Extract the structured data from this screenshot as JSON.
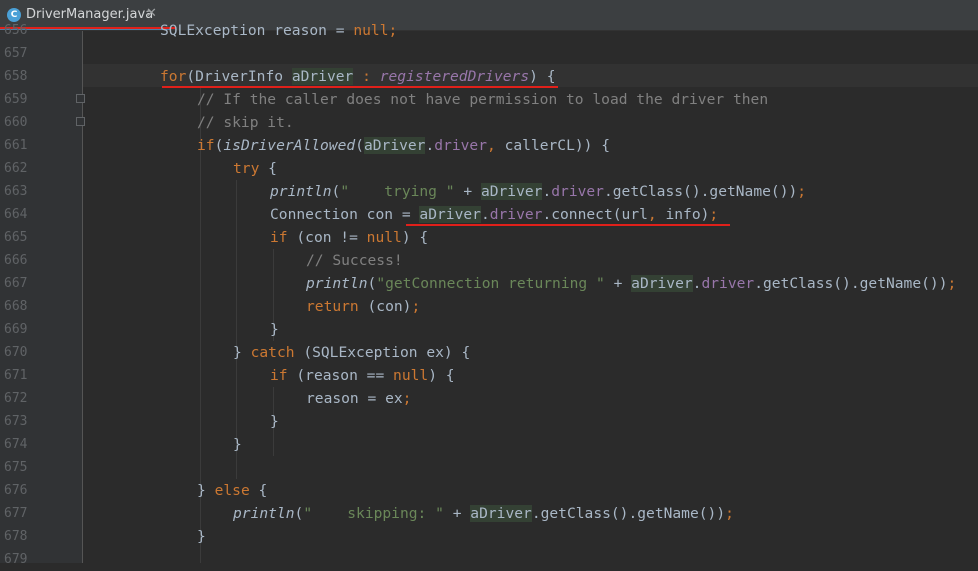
{
  "editor_tab": {
    "icon": "C",
    "file_name": "DriverManager.java",
    "close": "✕"
  },
  "line_numbers": [
    "656",
    "657",
    "658",
    "659",
    "660",
    "661",
    "662",
    "663",
    "664",
    "665",
    "666",
    "667",
    "668",
    "669",
    "670",
    "671",
    "672",
    "673",
    "674",
    "675",
    "676",
    "677",
    "678",
    "679"
  ],
  "code": {
    "l656": {
      "type": "SQLException",
      "name": "reason",
      "op": "=",
      "null": "null",
      "semi": ";"
    },
    "l658": {
      "kw": "for",
      "paren": "(",
      "type": "DriverInfo",
      "var": "aDriver",
      "colon": ":",
      "field": "registeredDrivers",
      "close": ")",
      "brace": "{"
    },
    "l659": {
      "comment": "// If the caller does not have permission to load the driver then"
    },
    "l660": {
      "comment": "// skip it."
    },
    "l661": {
      "kw": "if",
      "paren": "(",
      "method": "isDriverAllowed",
      "paren2": "(",
      "var": "aDriver",
      "dot": ".",
      "field": "driver",
      "comma": ",",
      "arg": "callerCL",
      "close": "))",
      "brace": "{"
    },
    "l662": {
      "kw": "try",
      "brace": "{"
    },
    "l663": {
      "method": "println",
      "paren": "(",
      "str": "\"    trying \"",
      "plus": "+",
      "var": "aDriver",
      "dot": ".",
      "field": "driver",
      "rest": ".getClass().getName())",
      "semi": ";"
    },
    "l664": {
      "type": "Connection",
      "name": "con",
      "op": "=",
      "var": "aDriver",
      "dot": ".",
      "field": "driver",
      "rest": ".connect(url",
      "comma": ",",
      "arg": "info)",
      "semi": ";"
    },
    "l665": {
      "kw": "if",
      "paren": "(con != ",
      "null": "null",
      "close": ")",
      "brace": "{"
    },
    "l666": {
      "comment": "// Success!"
    },
    "l667": {
      "method": "println",
      "paren": "(",
      "str": "\"getConnection returning \"",
      "plus": "+",
      "var": "aDriver",
      "dot": ".",
      "field": "driver",
      "rest": ".getClass().getName())",
      "semi": ";"
    },
    "l668": {
      "kw": "return",
      "rest": "(con)",
      "semi": ";"
    },
    "l669": {
      "brace": "}"
    },
    "l670": {
      "brace": "}",
      "kw": "catch",
      "rest": "(SQLException ex)",
      "brace2": "{"
    },
    "l671": {
      "kw": "if",
      "paren": "(reason == ",
      "null": "null",
      "close": ")",
      "brace": "{"
    },
    "l672": {
      "rest": "reason = ex",
      "semi": ";"
    },
    "l673": {
      "brace": "}"
    },
    "l674": {
      "brace": "}"
    },
    "l676": {
      "brace": "}",
      "kw": "else",
      "brace2": "{"
    },
    "l677": {
      "method": "println",
      "paren": "(",
      "str": "\"    skipping: \"",
      "plus": "+",
      "var": "aDriver",
      "rest": ".getClass().getName())",
      "semi": ";"
    },
    "l678": {
      "brace": "}"
    }
  },
  "colors": {
    "background": "#2b2b2b",
    "gutter": "#313335",
    "keyword": "#cc7832",
    "field": "#9876aa",
    "string": "#6a8759",
    "comment": "#808080",
    "text": "#a9b7c6",
    "annotation": "#e0201a"
  }
}
